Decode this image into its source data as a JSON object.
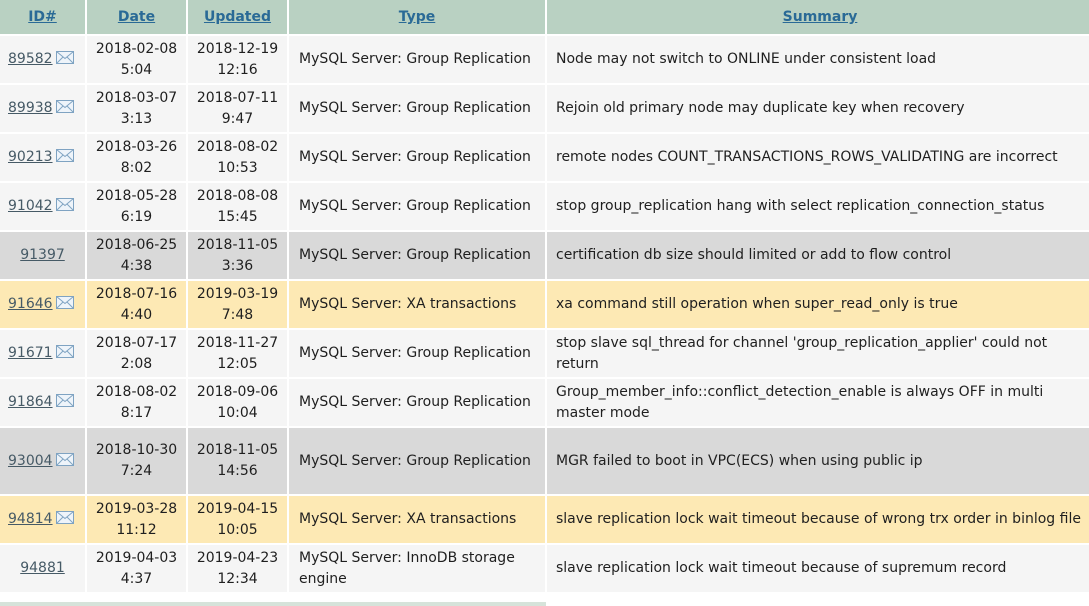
{
  "headers": {
    "id": "ID#",
    "date": "Date",
    "updated": "Updated",
    "type": "Type",
    "summary": "Summary"
  },
  "colors": {
    "header": "#b9d1c2",
    "link": "#2a6a96",
    "row_white": "#f5f5f5",
    "row_gray": "#d9d9d9",
    "row_yellow": "#fde9b4"
  },
  "rows": [
    {
      "id": "89582",
      "mail": true,
      "date": "2018-02-08",
      "date_time": "5:04",
      "updated": "2018-12-19",
      "updated_time": "12:16",
      "type": "MySQL Server: Group Replication",
      "summary": "Node may not switch to ONLINE under consistent load",
      "status_color": "white"
    },
    {
      "id": "89938",
      "mail": true,
      "date": "2018-03-07",
      "date_time": "3:13",
      "updated": "2018-07-11",
      "updated_time": "9:47",
      "type": "MySQL Server: Group Replication",
      "summary": "Rejoin old primary node may duplicate key when recovery",
      "status_color": "white"
    },
    {
      "id": "90213",
      "mail": true,
      "date": "2018-03-26",
      "date_time": "8:02",
      "updated": "2018-08-02",
      "updated_time": "10:53",
      "type": "MySQL Server: Group Replication",
      "summary": "remote nodes COUNT_TRANSACTIONS_ROWS_VALIDATING are incorrect",
      "status_color": "white"
    },
    {
      "id": "91042",
      "mail": true,
      "date": "2018-05-28",
      "date_time": "6:19",
      "updated": "2018-08-08",
      "updated_time": "15:45",
      "type": "MySQL Server: Group Replication",
      "summary": "stop group_replication hang with select replication_connection_status",
      "status_color": "white"
    },
    {
      "id": "91397",
      "mail": false,
      "date": "2018-06-25",
      "date_time": "4:38",
      "updated": "2018-11-05",
      "updated_time": "3:36",
      "type": "MySQL Server: Group Replication",
      "summary": "certification db size should limited or add to flow control",
      "status_color": "gray"
    },
    {
      "id": "91646",
      "mail": true,
      "date": "2018-07-16",
      "date_time": "4:40",
      "updated": "2019-03-19",
      "updated_time": "7:48",
      "type": "MySQL Server: XA transactions",
      "summary": "xa command still operation when super_read_only is true",
      "status_color": "yellow"
    },
    {
      "id": "91671",
      "mail": true,
      "date": "2018-07-17",
      "date_time": "2:08",
      "updated": "2018-11-27",
      "updated_time": "12:05",
      "type": "MySQL Server: Group Replication",
      "summary": "stop slave sql_thread for channel 'group_replication_applier' could not return",
      "status_color": "white"
    },
    {
      "id": "91864",
      "mail": true,
      "date": "2018-08-02",
      "date_time": "8:17",
      "updated": "2018-09-06",
      "updated_time": "10:04",
      "type": "MySQL Server: Group Replication",
      "summary": "Group_member_info::conflict_detection_enable is always OFF in multi master mode",
      "status_color": "white"
    },
    {
      "id": "93004",
      "mail": true,
      "date": "2018-10-30",
      "date_time": "7:24",
      "updated": "2018-11-05",
      "updated_time": "14:56",
      "type": "MySQL Server: Group Replication",
      "summary": "MGR failed to boot in VPC(ECS) when using public ip",
      "status_color": "gray",
      "tall": true
    },
    {
      "id": "94814",
      "mail": true,
      "date": "2019-03-28",
      "date_time": "11:12",
      "updated": "2019-04-15",
      "updated_time": "10:05",
      "type": "MySQL Server: XA transactions",
      "summary": "slave replication lock wait timeout because of wrong trx order in binlog file",
      "status_color": "yellow"
    },
    {
      "id": "94881",
      "mail": false,
      "date": "2019-04-03",
      "date_time": "4:37",
      "updated": "2019-04-23",
      "updated_time": "12:34",
      "type": "MySQL Server: InnoDB storage engine",
      "summary": "slave replication lock wait timeout because of supremum record",
      "status_color": "white"
    }
  ]
}
